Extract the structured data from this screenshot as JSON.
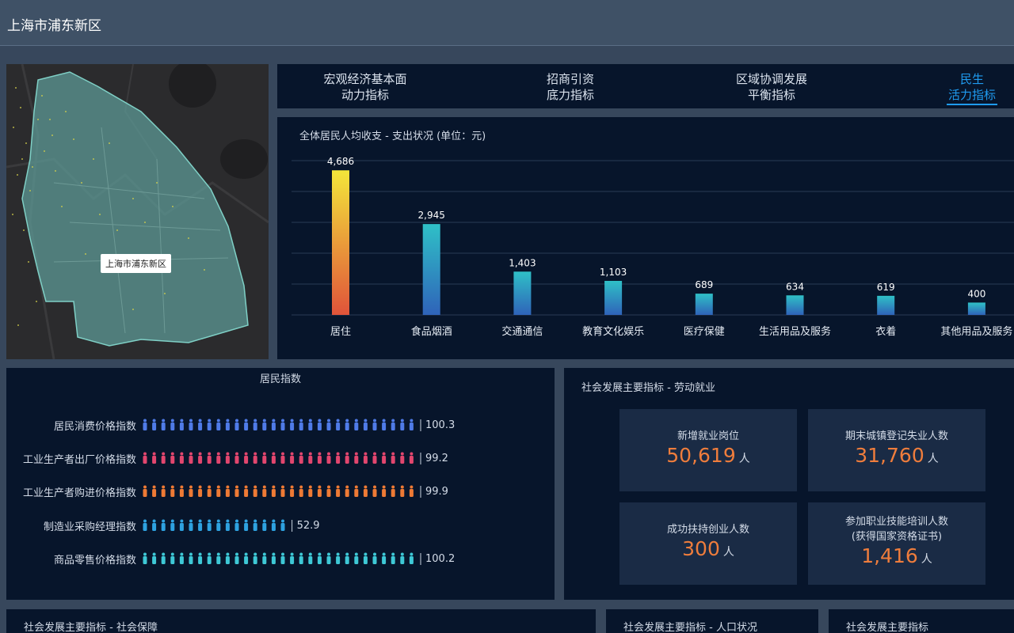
{
  "header": {
    "title": "上海市浦东新区"
  },
  "map": {
    "label": "上海市浦东新区"
  },
  "tabs": [
    {
      "line1": "宏观经济基本面",
      "line2": "动力指标",
      "active": false
    },
    {
      "line1": "招商引资",
      "line2": "底力指标",
      "active": false
    },
    {
      "line1": "区域协调发展",
      "line2": "平衡指标",
      "active": false
    },
    {
      "line1": "民生",
      "line2": "活力指标",
      "active": true
    }
  ],
  "chart_data": {
    "type": "bar",
    "title": "全体居民人均收支 - 支出状况 (单位：元)",
    "categories": [
      "居住",
      "食品烟酒",
      "交通通信",
      "教育文化娱乐",
      "医疗保健",
      "生活用品及服务",
      "衣着",
      "其他用品及服务"
    ],
    "values": [
      4686,
      2945,
      1403,
      1103,
      689,
      634,
      619,
      400
    ],
    "value_labels": [
      "4,686",
      "2,945",
      "1,403",
      "1,103",
      "689",
      "634",
      "619",
      "400"
    ],
    "ylim": [
      0,
      5000
    ],
    "grid": true,
    "colors": {
      "highlight_top": "#f3e63a",
      "highlight_bottom": "#e0533a",
      "bar_top": "#2fc0c7",
      "bar_bottom": "#2f63b9"
    }
  },
  "resident": {
    "title": "居民指数",
    "rows": [
      {
        "label": "居民消费价格指数",
        "value": "100.3",
        "count": 30,
        "color": "#4f7be8"
      },
      {
        "label": "工业生产者出厂价格指数",
        "value": "99.2",
        "count": 30,
        "color": "#e2466e"
      },
      {
        "label": "工业生产者购进价格指数",
        "value": "99.9",
        "count": 30,
        "color": "#ee7a35"
      },
      {
        "label": "制造业采购经理指数",
        "value": "52.9",
        "count": 16,
        "color": "#2ea2e0"
      },
      {
        "label": "商品零售价格指数",
        "value": "100.2",
        "count": 30,
        "color": "#3ec8d6"
      }
    ]
  },
  "labor": {
    "title": "社会发展主要指标 - 劳动就业",
    "cards": [
      {
        "label1": "新增就业岗位",
        "label2": "",
        "value": "50,619",
        "unit": "人"
      },
      {
        "label1": "期末城镇登记失业人数",
        "label2": "",
        "value": "31,760",
        "unit": "人"
      },
      {
        "label1": "成功扶持创业人数",
        "label2": "",
        "value": "300",
        "unit": "人"
      },
      {
        "label1": "参加职业技能培训人数",
        "label2": "(获得国家资格证书)",
        "value": "1,416",
        "unit": "人"
      }
    ]
  },
  "bottom": [
    {
      "title": "社会发展主要指标 - 社会保障"
    },
    {
      "title": "社会发展主要指标 - 人口状况"
    },
    {
      "title": "社会发展主要指标"
    }
  ]
}
